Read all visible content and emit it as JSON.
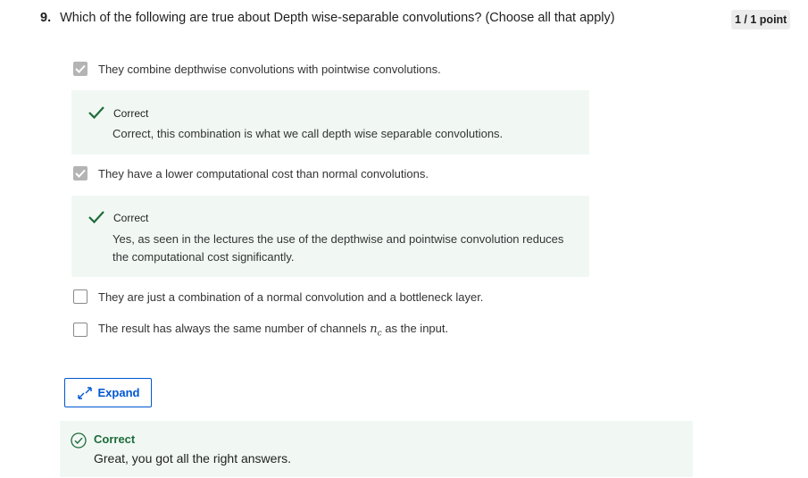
{
  "question": {
    "number": "9.",
    "text": "Which of the following are true about Depth wise-separable convolutions? (Choose all that apply)",
    "points": "1 / 1 point"
  },
  "options": [
    {
      "text": "They combine depthwise convolutions with pointwise convolutions.",
      "checked": true,
      "feedback": {
        "title": "Correct",
        "text": "Correct, this combination is what we call depth wise separable convolutions."
      }
    },
    {
      "text": "They have a lower computational cost than normal convolutions.",
      "checked": true,
      "feedback": {
        "title": "Correct",
        "text": "Yes, as seen in the lectures the use of the depthwise and pointwise convolution reduces the computational cost significantly."
      }
    },
    {
      "text": "They are just a combination of a normal convolution and a bottleneck layer.",
      "checked": false
    },
    {
      "text_before": "The result has always the same number of channels",
      "math": "n",
      "math_sub": "c",
      "text_after": "as the input.",
      "checked": false
    }
  ],
  "expand_button": {
    "label": "Expand",
    "icon": "expand-arrows-icon"
  },
  "summary": {
    "title": "Correct",
    "text": "Great, you got all the right answers.",
    "icon": "check-circle-icon"
  },
  "colors": {
    "correct_green": "#1e6b3a",
    "feedback_bg": "#f1f8f4",
    "link_blue": "#0056d2",
    "checkbox_checked": "#b4b4b4"
  }
}
